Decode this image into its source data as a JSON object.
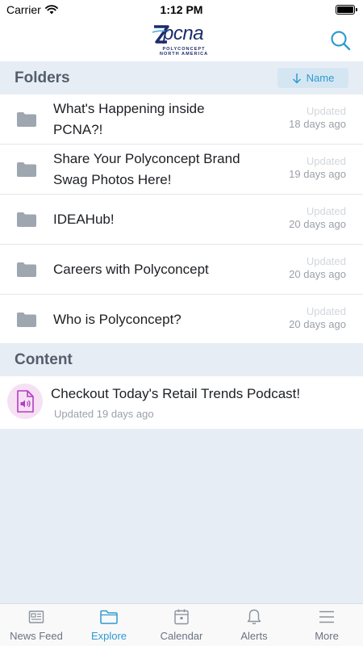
{
  "status_bar": {
    "carrier": "Carrier",
    "time": "1:12 PM"
  },
  "header": {
    "logo_wordmark": "pcna",
    "logo_line1": "POLYCONCEPT",
    "logo_line2": "NORTH AMERICA"
  },
  "folders_section": {
    "title": "Folders",
    "sort_label": "Name",
    "items": [
      {
        "name": "What's Happening inside PCNA?!",
        "updated_label": "Updated",
        "updated_age": "18 days ago"
      },
      {
        "name": "Share Your Polyconcept Brand Swag Photos Here!",
        "updated_label": "Updated",
        "updated_age": "19 days ago"
      },
      {
        "name": "IDEAHub!",
        "updated_label": "Updated",
        "updated_age": "20 days ago"
      },
      {
        "name": "Careers with Polyconcept",
        "updated_label": "Updated",
        "updated_age": "20 days ago"
      },
      {
        "name": "Who is Polyconcept?",
        "updated_label": "Updated",
        "updated_age": "20 days ago"
      }
    ]
  },
  "content_section": {
    "title": "Content",
    "items": [
      {
        "title": "Checkout Today's Retail Trends Podcast!",
        "updated": "Updated 19 days ago",
        "icon": "audio-file-icon"
      }
    ]
  },
  "tab_bar": {
    "tabs": [
      {
        "label": "News Feed",
        "icon": "newspaper-icon",
        "active": false
      },
      {
        "label": "Explore",
        "icon": "folder-icon",
        "active": true
      },
      {
        "label": "Calendar",
        "icon": "calendar-icon",
        "active": false
      },
      {
        "label": "Alerts",
        "icon": "bell-icon",
        "active": false
      },
      {
        "label": "More",
        "icon": "menu-icon",
        "active": false
      }
    ]
  },
  "colors": {
    "accent": "#2e9ad0",
    "section_bg": "#e7edf5",
    "brand_navy": "#1c2c6b",
    "audio_icon": "#b33fc4"
  }
}
